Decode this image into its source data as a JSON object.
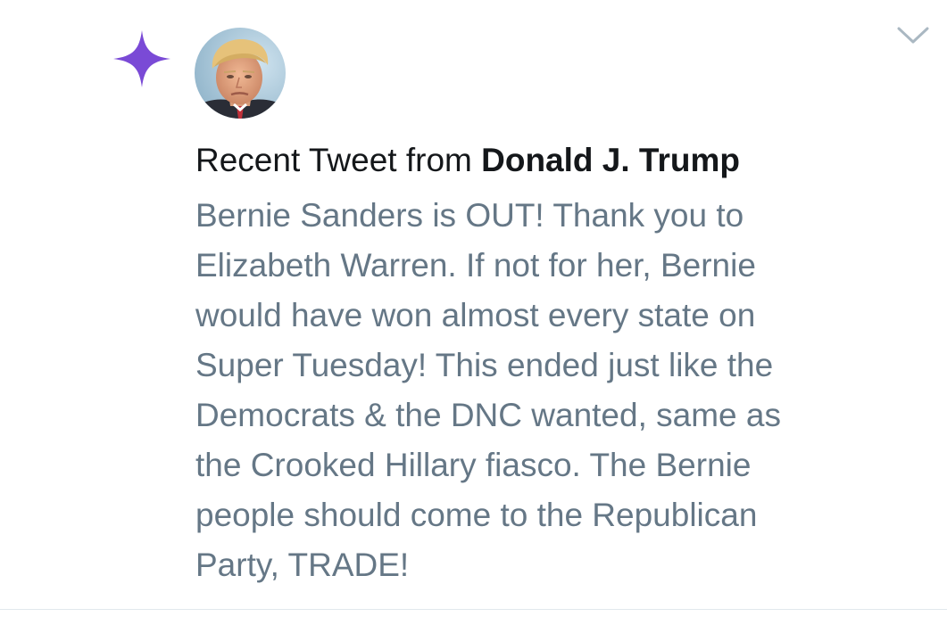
{
  "icons": {
    "spark": "spark-icon",
    "chevron": "chevron-down-icon"
  },
  "colors": {
    "spark": "#7a4ad6",
    "headline": "#14171a",
    "body": "#657786",
    "chevron": "#aab8c2",
    "divider": "#e1e8ed"
  },
  "notification": {
    "headline_prefix": "Recent Tweet from ",
    "author": "Donald J. Trump",
    "tweet_lines": [
      "Bernie Sanders is OUT! Thank you to",
      "Elizabeth Warren. If not for her, Bernie",
      "would have won almost every state on",
      "Super Tuesday! This ended just like the",
      "Democrats & the DNC wanted, same as",
      "the Crooked Hillary fiasco. The Bernie",
      "people should come to the Republican",
      "Party, TRADE!"
    ]
  }
}
